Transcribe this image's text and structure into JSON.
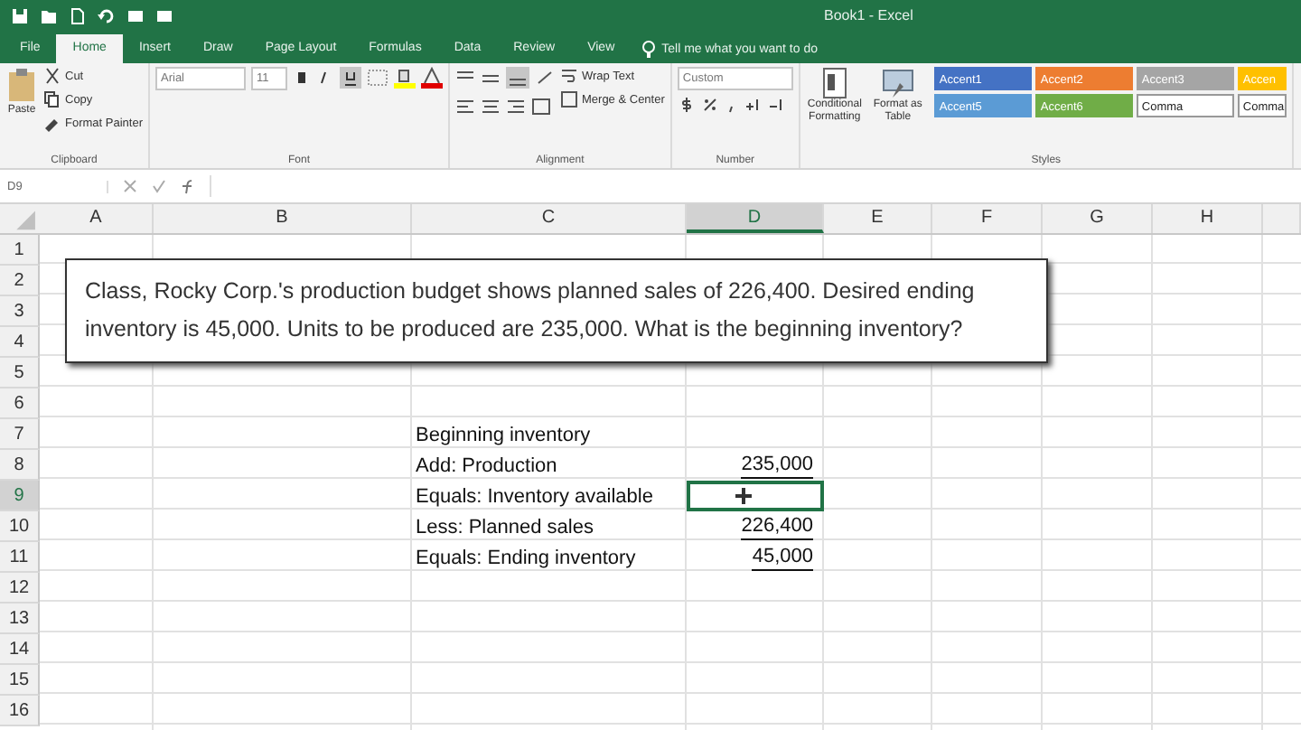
{
  "window": {
    "title": "Book1 - Excel"
  },
  "tabs": [
    {
      "label": "File",
      "selected": false
    },
    {
      "label": "Home",
      "selected": true
    },
    {
      "label": "Insert",
      "selected": false
    },
    {
      "label": "Draw",
      "selected": false
    },
    {
      "label": "Page Layout",
      "selected": false
    },
    {
      "label": "Formulas",
      "selected": false
    },
    {
      "label": "Data",
      "selected": false
    },
    {
      "label": "Review",
      "selected": false
    },
    {
      "label": "View",
      "selected": false
    }
  ],
  "tell_me": {
    "placeholder": "Tell me what you want to do"
  },
  "ribbon": {
    "clipboard": {
      "paste": "Paste",
      "cut": "Cut",
      "copy": "Copy",
      "painter": "Format Painter",
      "label": "Clipboard"
    },
    "font": {
      "name": "Arial",
      "size": "11",
      "label": "Font"
    },
    "alignment": {
      "wrap": "Wrap Text",
      "merge": "Merge & Center",
      "label": "Alignment"
    },
    "number": {
      "format": "Custom",
      "label": "Number"
    },
    "styles": {
      "conditional": "Conditional Formatting",
      "table": "Format as Table",
      "label": "Styles",
      "cell_styles": [
        {
          "label": "Accent1",
          "color": "#4472c4"
        },
        {
          "label": "Accent2",
          "color": "#ed7d31"
        },
        {
          "label": "Accent3",
          "color": "#a5a5a5"
        },
        {
          "label": "Accen",
          "color": "#ffc000"
        },
        {
          "label": "Accent5",
          "color": "#5b9bd5"
        },
        {
          "label": "Accent6",
          "color": "#70ad47"
        },
        {
          "label": "Comma",
          "color": "#ffffff"
        },
        {
          "label": "Comma",
          "color": "#ffffff"
        }
      ]
    }
  },
  "name_box": "D9",
  "columns": [
    {
      "label": "A",
      "selected": false
    },
    {
      "label": "B",
      "selected": false
    },
    {
      "label": "C",
      "selected": false
    },
    {
      "label": "D",
      "selected": true
    },
    {
      "label": "E",
      "selected": false
    },
    {
      "label": "F",
      "selected": false
    },
    {
      "label": "G",
      "selected": false
    },
    {
      "label": "H",
      "selected": false
    }
  ],
  "rows": [
    {
      "number": "1",
      "selected": false
    },
    {
      "number": "2",
      "selected": false
    },
    {
      "number": "3",
      "selected": false
    },
    {
      "number": "4",
      "selected": false
    },
    {
      "number": "5",
      "selected": false
    },
    {
      "number": "6",
      "selected": false
    },
    {
      "number": "7",
      "selected": false,
      "cell_c": {
        "text": "Beginning inventory"
      }
    },
    {
      "number": "8",
      "selected": false,
      "cell_c": {
        "text": "Add: Production"
      },
      "cell_d": {
        "text": "235,000",
        "underlined": true
      }
    },
    {
      "number": "9",
      "selected": true,
      "cell_c": {
        "text": "Equals: Inventory available"
      },
      "cell_d": {
        "selected": true
      }
    },
    {
      "number": "10",
      "selected": false,
      "cell_c": {
        "text": "Less: Planned sales"
      },
      "cell_d": {
        "text": "226,400",
        "underlined": true
      }
    },
    {
      "number": "11",
      "selected": false,
      "cell_c": {
        "text": "Equals: Ending inventory"
      },
      "cell_d": {
        "text": "45,000",
        "underlined": true
      }
    },
    {
      "number": "12",
      "selected": false
    },
    {
      "number": "13",
      "selected": false
    },
    {
      "number": "14",
      "selected": false
    },
    {
      "number": "15",
      "selected": false
    },
    {
      "number": "16",
      "selected": false
    }
  ],
  "text_box": {
    "text": "Class, Rocky Corp.'s production budget shows planned sales of 226,400. Desired ending inventory is 45,000. Units to be produced are 235,000.  What is the beginning inventory?"
  }
}
